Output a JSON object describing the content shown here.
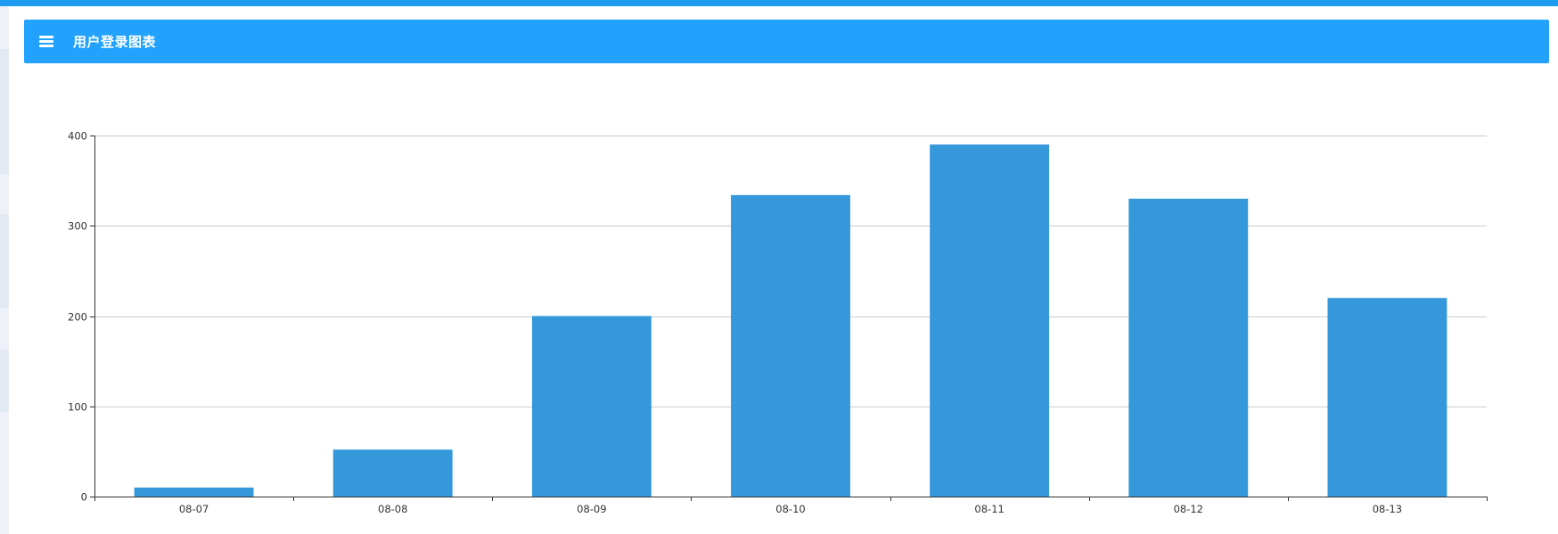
{
  "header": {
    "title": "用户登录图表",
    "menu_icon": "hamburger-menu-icon",
    "background_color": "#22a2fd"
  },
  "chart_data": {
    "type": "bar",
    "title": "",
    "xlabel": "",
    "ylabel": "",
    "categories": [
      "08-07",
      "08-08",
      "08-09",
      "08-10",
      "08-11",
      "08-12",
      "08-13"
    ],
    "values": [
      10,
      52,
      200,
      334,
      390,
      330,
      220
    ],
    "ylim": [
      0,
      400
    ],
    "yticks": [
      0,
      100,
      200,
      300,
      400
    ],
    "grid": true,
    "legend": "none",
    "bar_color": "#3498db"
  }
}
